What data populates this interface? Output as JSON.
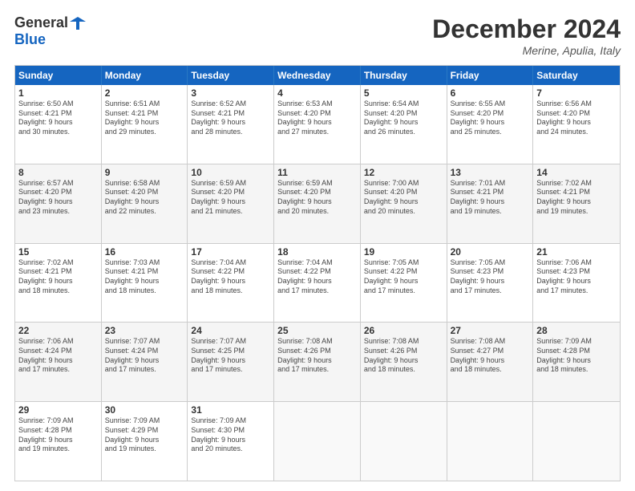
{
  "logo": {
    "general": "General",
    "blue": "Blue"
  },
  "header": {
    "month": "December 2024",
    "location": "Merine, Apulia, Italy"
  },
  "weekdays": [
    "Sunday",
    "Monday",
    "Tuesday",
    "Wednesday",
    "Thursday",
    "Friday",
    "Saturday"
  ],
  "rows": [
    [
      {
        "day": "1",
        "lines": [
          "Sunrise: 6:50 AM",
          "Sunset: 4:21 PM",
          "Daylight: 9 hours",
          "and 30 minutes."
        ]
      },
      {
        "day": "2",
        "lines": [
          "Sunrise: 6:51 AM",
          "Sunset: 4:21 PM",
          "Daylight: 9 hours",
          "and 29 minutes."
        ]
      },
      {
        "day": "3",
        "lines": [
          "Sunrise: 6:52 AM",
          "Sunset: 4:21 PM",
          "Daylight: 9 hours",
          "and 28 minutes."
        ]
      },
      {
        "day": "4",
        "lines": [
          "Sunrise: 6:53 AM",
          "Sunset: 4:20 PM",
          "Daylight: 9 hours",
          "and 27 minutes."
        ]
      },
      {
        "day": "5",
        "lines": [
          "Sunrise: 6:54 AM",
          "Sunset: 4:20 PM",
          "Daylight: 9 hours",
          "and 26 minutes."
        ]
      },
      {
        "day": "6",
        "lines": [
          "Sunrise: 6:55 AM",
          "Sunset: 4:20 PM",
          "Daylight: 9 hours",
          "and 25 minutes."
        ]
      },
      {
        "day": "7",
        "lines": [
          "Sunrise: 6:56 AM",
          "Sunset: 4:20 PM",
          "Daylight: 9 hours",
          "and 24 minutes."
        ]
      }
    ],
    [
      {
        "day": "8",
        "lines": [
          "Sunrise: 6:57 AM",
          "Sunset: 4:20 PM",
          "Daylight: 9 hours",
          "and 23 minutes."
        ]
      },
      {
        "day": "9",
        "lines": [
          "Sunrise: 6:58 AM",
          "Sunset: 4:20 PM",
          "Daylight: 9 hours",
          "and 22 minutes."
        ]
      },
      {
        "day": "10",
        "lines": [
          "Sunrise: 6:59 AM",
          "Sunset: 4:20 PM",
          "Daylight: 9 hours",
          "and 21 minutes."
        ]
      },
      {
        "day": "11",
        "lines": [
          "Sunrise: 6:59 AM",
          "Sunset: 4:20 PM",
          "Daylight: 9 hours",
          "and 20 minutes."
        ]
      },
      {
        "day": "12",
        "lines": [
          "Sunrise: 7:00 AM",
          "Sunset: 4:20 PM",
          "Daylight: 9 hours",
          "and 20 minutes."
        ]
      },
      {
        "day": "13",
        "lines": [
          "Sunrise: 7:01 AM",
          "Sunset: 4:21 PM",
          "Daylight: 9 hours",
          "and 19 minutes."
        ]
      },
      {
        "day": "14",
        "lines": [
          "Sunrise: 7:02 AM",
          "Sunset: 4:21 PM",
          "Daylight: 9 hours",
          "and 19 minutes."
        ]
      }
    ],
    [
      {
        "day": "15",
        "lines": [
          "Sunrise: 7:02 AM",
          "Sunset: 4:21 PM",
          "Daylight: 9 hours",
          "and 18 minutes."
        ]
      },
      {
        "day": "16",
        "lines": [
          "Sunrise: 7:03 AM",
          "Sunset: 4:21 PM",
          "Daylight: 9 hours",
          "and 18 minutes."
        ]
      },
      {
        "day": "17",
        "lines": [
          "Sunrise: 7:04 AM",
          "Sunset: 4:22 PM",
          "Daylight: 9 hours",
          "and 18 minutes."
        ]
      },
      {
        "day": "18",
        "lines": [
          "Sunrise: 7:04 AM",
          "Sunset: 4:22 PM",
          "Daylight: 9 hours",
          "and 17 minutes."
        ]
      },
      {
        "day": "19",
        "lines": [
          "Sunrise: 7:05 AM",
          "Sunset: 4:22 PM",
          "Daylight: 9 hours",
          "and 17 minutes."
        ]
      },
      {
        "day": "20",
        "lines": [
          "Sunrise: 7:05 AM",
          "Sunset: 4:23 PM",
          "Daylight: 9 hours",
          "and 17 minutes."
        ]
      },
      {
        "day": "21",
        "lines": [
          "Sunrise: 7:06 AM",
          "Sunset: 4:23 PM",
          "Daylight: 9 hours",
          "and 17 minutes."
        ]
      }
    ],
    [
      {
        "day": "22",
        "lines": [
          "Sunrise: 7:06 AM",
          "Sunset: 4:24 PM",
          "Daylight: 9 hours",
          "and 17 minutes."
        ]
      },
      {
        "day": "23",
        "lines": [
          "Sunrise: 7:07 AM",
          "Sunset: 4:24 PM",
          "Daylight: 9 hours",
          "and 17 minutes."
        ]
      },
      {
        "day": "24",
        "lines": [
          "Sunrise: 7:07 AM",
          "Sunset: 4:25 PM",
          "Daylight: 9 hours",
          "and 17 minutes."
        ]
      },
      {
        "day": "25",
        "lines": [
          "Sunrise: 7:08 AM",
          "Sunset: 4:26 PM",
          "Daylight: 9 hours",
          "and 17 minutes."
        ]
      },
      {
        "day": "26",
        "lines": [
          "Sunrise: 7:08 AM",
          "Sunset: 4:26 PM",
          "Daylight: 9 hours",
          "and 18 minutes."
        ]
      },
      {
        "day": "27",
        "lines": [
          "Sunrise: 7:08 AM",
          "Sunset: 4:27 PM",
          "Daylight: 9 hours",
          "and 18 minutes."
        ]
      },
      {
        "day": "28",
        "lines": [
          "Sunrise: 7:09 AM",
          "Sunset: 4:28 PM",
          "Daylight: 9 hours",
          "and 18 minutes."
        ]
      }
    ],
    [
      {
        "day": "29",
        "lines": [
          "Sunrise: 7:09 AM",
          "Sunset: 4:28 PM",
          "Daylight: 9 hours",
          "and 19 minutes."
        ]
      },
      {
        "day": "30",
        "lines": [
          "Sunrise: 7:09 AM",
          "Sunset: 4:29 PM",
          "Daylight: 9 hours",
          "and 19 minutes."
        ]
      },
      {
        "day": "31",
        "lines": [
          "Sunrise: 7:09 AM",
          "Sunset: 4:30 PM",
          "Daylight: 9 hours",
          "and 20 minutes."
        ]
      },
      {
        "day": "",
        "lines": []
      },
      {
        "day": "",
        "lines": []
      },
      {
        "day": "",
        "lines": []
      },
      {
        "day": "",
        "lines": []
      }
    ]
  ]
}
